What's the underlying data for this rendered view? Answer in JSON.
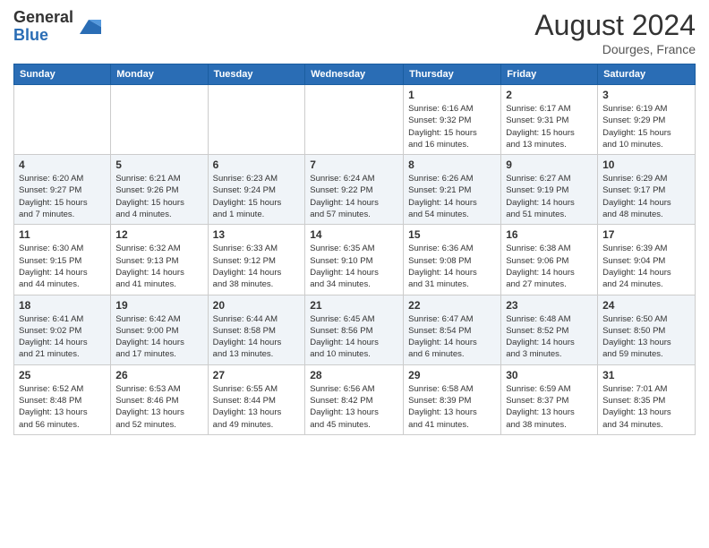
{
  "header": {
    "logo_general": "General",
    "logo_blue": "Blue",
    "month_year": "August 2024",
    "location": "Dourges, France"
  },
  "days_of_week": [
    "Sunday",
    "Monday",
    "Tuesday",
    "Wednesday",
    "Thursday",
    "Friday",
    "Saturday"
  ],
  "weeks": [
    [
      {
        "day": "",
        "info": ""
      },
      {
        "day": "",
        "info": ""
      },
      {
        "day": "",
        "info": ""
      },
      {
        "day": "",
        "info": ""
      },
      {
        "day": "1",
        "info": "Sunrise: 6:16 AM\nSunset: 9:32 PM\nDaylight: 15 hours\nand 16 minutes."
      },
      {
        "day": "2",
        "info": "Sunrise: 6:17 AM\nSunset: 9:31 PM\nDaylight: 15 hours\nand 13 minutes."
      },
      {
        "day": "3",
        "info": "Sunrise: 6:19 AM\nSunset: 9:29 PM\nDaylight: 15 hours\nand 10 minutes."
      }
    ],
    [
      {
        "day": "4",
        "info": "Sunrise: 6:20 AM\nSunset: 9:27 PM\nDaylight: 15 hours\nand 7 minutes."
      },
      {
        "day": "5",
        "info": "Sunrise: 6:21 AM\nSunset: 9:26 PM\nDaylight: 15 hours\nand 4 minutes."
      },
      {
        "day": "6",
        "info": "Sunrise: 6:23 AM\nSunset: 9:24 PM\nDaylight: 15 hours\nand 1 minute."
      },
      {
        "day": "7",
        "info": "Sunrise: 6:24 AM\nSunset: 9:22 PM\nDaylight: 14 hours\nand 57 minutes."
      },
      {
        "day": "8",
        "info": "Sunrise: 6:26 AM\nSunset: 9:21 PM\nDaylight: 14 hours\nand 54 minutes."
      },
      {
        "day": "9",
        "info": "Sunrise: 6:27 AM\nSunset: 9:19 PM\nDaylight: 14 hours\nand 51 minutes."
      },
      {
        "day": "10",
        "info": "Sunrise: 6:29 AM\nSunset: 9:17 PM\nDaylight: 14 hours\nand 48 minutes."
      }
    ],
    [
      {
        "day": "11",
        "info": "Sunrise: 6:30 AM\nSunset: 9:15 PM\nDaylight: 14 hours\nand 44 minutes."
      },
      {
        "day": "12",
        "info": "Sunrise: 6:32 AM\nSunset: 9:13 PM\nDaylight: 14 hours\nand 41 minutes."
      },
      {
        "day": "13",
        "info": "Sunrise: 6:33 AM\nSunset: 9:12 PM\nDaylight: 14 hours\nand 38 minutes."
      },
      {
        "day": "14",
        "info": "Sunrise: 6:35 AM\nSunset: 9:10 PM\nDaylight: 14 hours\nand 34 minutes."
      },
      {
        "day": "15",
        "info": "Sunrise: 6:36 AM\nSunset: 9:08 PM\nDaylight: 14 hours\nand 31 minutes."
      },
      {
        "day": "16",
        "info": "Sunrise: 6:38 AM\nSunset: 9:06 PM\nDaylight: 14 hours\nand 27 minutes."
      },
      {
        "day": "17",
        "info": "Sunrise: 6:39 AM\nSunset: 9:04 PM\nDaylight: 14 hours\nand 24 minutes."
      }
    ],
    [
      {
        "day": "18",
        "info": "Sunrise: 6:41 AM\nSunset: 9:02 PM\nDaylight: 14 hours\nand 21 minutes."
      },
      {
        "day": "19",
        "info": "Sunrise: 6:42 AM\nSunset: 9:00 PM\nDaylight: 14 hours\nand 17 minutes."
      },
      {
        "day": "20",
        "info": "Sunrise: 6:44 AM\nSunset: 8:58 PM\nDaylight: 14 hours\nand 13 minutes."
      },
      {
        "day": "21",
        "info": "Sunrise: 6:45 AM\nSunset: 8:56 PM\nDaylight: 14 hours\nand 10 minutes."
      },
      {
        "day": "22",
        "info": "Sunrise: 6:47 AM\nSunset: 8:54 PM\nDaylight: 14 hours\nand 6 minutes."
      },
      {
        "day": "23",
        "info": "Sunrise: 6:48 AM\nSunset: 8:52 PM\nDaylight: 14 hours\nand 3 minutes."
      },
      {
        "day": "24",
        "info": "Sunrise: 6:50 AM\nSunset: 8:50 PM\nDaylight: 13 hours\nand 59 minutes."
      }
    ],
    [
      {
        "day": "25",
        "info": "Sunrise: 6:52 AM\nSunset: 8:48 PM\nDaylight: 13 hours\nand 56 minutes."
      },
      {
        "day": "26",
        "info": "Sunrise: 6:53 AM\nSunset: 8:46 PM\nDaylight: 13 hours\nand 52 minutes."
      },
      {
        "day": "27",
        "info": "Sunrise: 6:55 AM\nSunset: 8:44 PM\nDaylight: 13 hours\nand 49 minutes."
      },
      {
        "day": "28",
        "info": "Sunrise: 6:56 AM\nSunset: 8:42 PM\nDaylight: 13 hours\nand 45 minutes."
      },
      {
        "day": "29",
        "info": "Sunrise: 6:58 AM\nSunset: 8:39 PM\nDaylight: 13 hours\nand 41 minutes."
      },
      {
        "day": "30",
        "info": "Sunrise: 6:59 AM\nSunset: 8:37 PM\nDaylight: 13 hours\nand 38 minutes."
      },
      {
        "day": "31",
        "info": "Sunrise: 7:01 AM\nSunset: 8:35 PM\nDaylight: 13 hours\nand 34 minutes."
      }
    ]
  ]
}
